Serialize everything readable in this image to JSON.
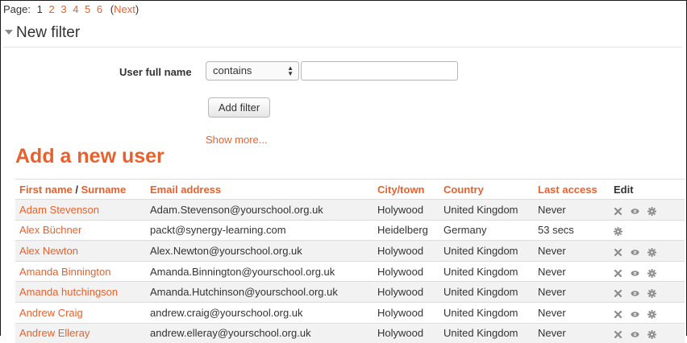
{
  "pager": {
    "label": "Page:",
    "current": "1",
    "pages": [
      "2",
      "3",
      "4",
      "5",
      "6"
    ],
    "paren_open": "(",
    "next": "Next",
    "paren_close": ")"
  },
  "filter": {
    "title": "New filter",
    "field_label": "User full name",
    "select_value": "contains",
    "text_value": "",
    "add_button": "Add filter",
    "show_more": "Show more..."
  },
  "add_user_link": "Add a new user",
  "table": {
    "headers": {
      "first_name": "First name",
      "slash": " / ",
      "surname": "Surname",
      "email": "Email address",
      "city": "City/town",
      "country": "Country",
      "last_access": "Last access",
      "edit": "Edit"
    },
    "rows": [
      {
        "name": "Adam Stevenson",
        "email": "Adam.Stevenson@yourschool.org.uk",
        "city": "Holywood",
        "country": "United Kingdom",
        "last": "Never",
        "icons": [
          "delete-icon",
          "view-icon",
          "settings-icon"
        ]
      },
      {
        "name": "Alex Büchner",
        "email": "packt@synergy-learning.com",
        "city": "Heidelberg",
        "country": "Germany",
        "last": "53 secs",
        "icons": [
          "settings-icon"
        ]
      },
      {
        "name": "Alex Newton",
        "email": "Alex.Newton@yourschool.org.uk",
        "city": "Holywood",
        "country": "United Kingdom",
        "last": "Never",
        "icons": [
          "delete-icon",
          "view-icon",
          "settings-icon"
        ]
      },
      {
        "name": "Amanda Binnington",
        "email": "Amanda.Binnington@yourschool.org.uk",
        "city": "Holywood",
        "country": "United Kingdom",
        "last": "Never",
        "icons": [
          "delete-icon",
          "view-icon",
          "settings-icon"
        ]
      },
      {
        "name": "Amanda hutchingson",
        "email": "Amanda.Hutchinson@yourschool.org.uk",
        "city": "Holywood",
        "country": "United Kingdom",
        "last": "Never",
        "icons": [
          "delete-icon",
          "view-icon",
          "settings-icon"
        ]
      },
      {
        "name": "Andrew Craig",
        "email": "andrew.craig@yourschool.org.uk",
        "city": "Holywood",
        "country": "United Kingdom",
        "last": "Never",
        "icons": [
          "delete-icon",
          "view-icon",
          "settings-icon"
        ]
      },
      {
        "name": "Andrew Elleray",
        "email": "andrew.elleray@yourschool.org.uk",
        "city": "Holywood",
        "country": "United Kingdom",
        "last": "Never",
        "icons": [
          "delete-icon",
          "view-icon",
          "settings-icon"
        ]
      }
    ]
  },
  "colors": {
    "accent": "#e8612c",
    "text": "#333333",
    "row_stripe": "#f2f2f2",
    "icon": "#8c8c8c"
  }
}
